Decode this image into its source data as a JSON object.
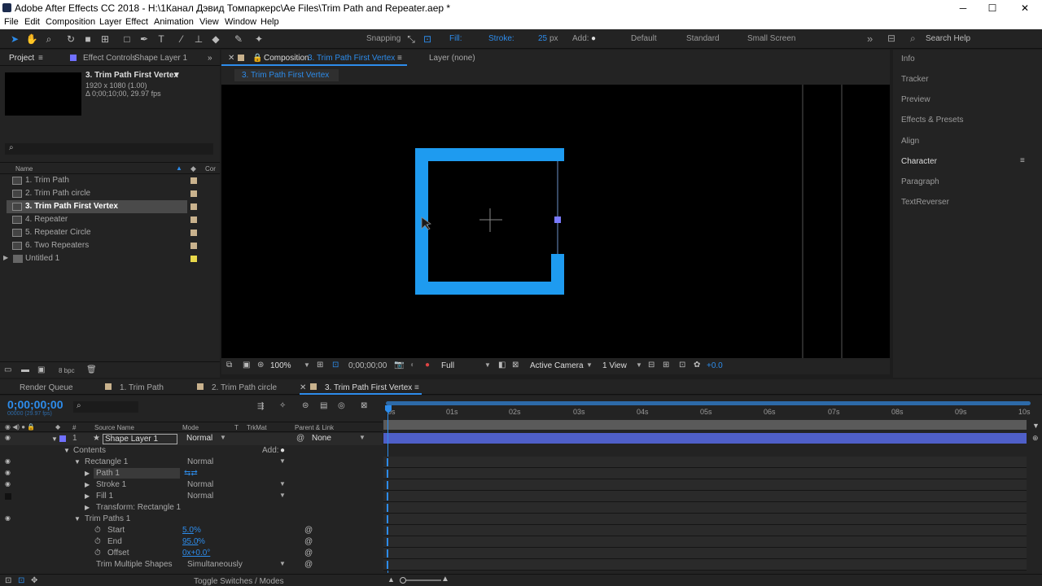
{
  "window": {
    "title": "Adobe After Effects CC 2018 - H:\\1Канал Дэвид Томпаркерс\\Ae Files\\Trim Path and Repeater.aep *",
    "min": "─",
    "max": "☐",
    "close": "✕"
  },
  "menu": [
    "File",
    "Edit",
    "Composition",
    "Layer",
    "Effect",
    "Animation",
    "View",
    "Window",
    "Help"
  ],
  "toolbar": {
    "snapping": "Snapping",
    "fill": "Fill:",
    "stroke": "Stroke:",
    "stroke_px": "25",
    "px": "px",
    "add": "Add:",
    "workspaces": [
      "Default",
      "Standard",
      "Small Screen"
    ],
    "search": "Search Help",
    "overflow": "»"
  },
  "project": {
    "tab_project": "Project",
    "tab_effects": "Effect Controls",
    "tab_effects_layer": "Shape Layer 1",
    "selected_name": "3. Trim Path First Vertex",
    "selected_res": "1920 x 1080 (1.00)",
    "selected_dur": "Δ 0;00;10;00, 29.97 fps",
    "col_name": "Name",
    "col_comment": "Cor",
    "bpc": "8 bpc",
    "items": [
      {
        "name": "1. Trim Path"
      },
      {
        "name": "2. Trim Path circle"
      },
      {
        "name": "3. Trim Path First Vertex"
      },
      {
        "name": "4. Repeater"
      },
      {
        "name": "5. Repeater Circle"
      },
      {
        "name": "6. Two Repeaters"
      },
      {
        "name": "Untitled 1"
      }
    ]
  },
  "comp": {
    "tab_label": "Composition",
    "tab_name": "3. Trim Path First Vertex",
    "layer_tab": "Layer (none)",
    "breadcrumb": "3. Trim Path First Vertex",
    "zoom": "100%",
    "time": "0;00;00;00",
    "resolution": "Full",
    "camera": "Active Camera",
    "views": "1 View",
    "exposure": "+0.0"
  },
  "right_panels": [
    "Info",
    "Tracker",
    "Preview",
    "Effects & Presets",
    "Align",
    "Character",
    "Paragraph",
    "TextReverser"
  ],
  "timeline": {
    "tabs": [
      "Render Queue",
      "1. Trim Path",
      "2. Trim Path circle",
      "3. Trim Path First Vertex"
    ],
    "timecode": "0;00;00;00",
    "frame_info": "00000 (29.97 fps)",
    "cols": {
      "num": "#",
      "source": "Source Name",
      "mode": "Mode",
      "t": "T",
      "trkmat": "TrkMat",
      "parent": "Parent & Link"
    },
    "layer": {
      "num": "1",
      "name": "Shape Layer 1",
      "mode": "Normal",
      "parent": "None"
    },
    "contents": "Contents",
    "add": "Add:",
    "rect": "Rectangle 1",
    "rect_mode": "Normal",
    "path": "Path 1",
    "stroke": "Stroke 1",
    "stroke_mode": "Normal",
    "fill": "Fill 1",
    "fill_mode": "Normal",
    "transform": "Transform: Rectangle 1",
    "trim": "Trim Paths 1",
    "start_label": "Start",
    "start_val": "5.0",
    "end_label": "End",
    "end_val": "95.0",
    "pct": "%",
    "offset_label": "Offset",
    "offset_val": "0x+0.0°",
    "trim_multi": "Trim Multiple Shapes",
    "trim_multi_val": "Simultaneously",
    "toggle": "Toggle Switches / Modes",
    "ruler": [
      "0s",
      "01s",
      "02s",
      "03s",
      "04s",
      "05s",
      "06s",
      "07s",
      "08s",
      "09s",
      "10s"
    ]
  },
  "colors": {
    "accent": "#2d8ceb",
    "shape": "#1e9bf0",
    "label_tan": "#c9b28d",
    "label_yellow": "#e8d84a",
    "layer_bar": "#4f5fc8"
  }
}
